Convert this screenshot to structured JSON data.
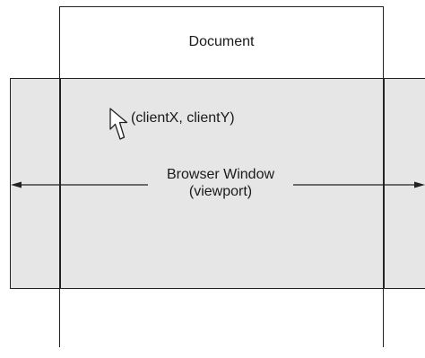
{
  "document": {
    "label": "Document"
  },
  "viewport": {
    "title": "Browser Window",
    "subtitle": "(viewport)"
  },
  "pointer": {
    "coordinates_label": "(clientX, clientY)",
    "icon": "mouse-pointer-icon"
  },
  "colors": {
    "viewport_fill": "#e6e6e7",
    "stroke": "#222222",
    "page_background": "#ffffff"
  }
}
